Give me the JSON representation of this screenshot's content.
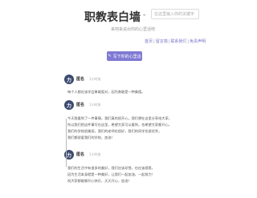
{
  "header": {
    "title": "职教表白墙",
    "separator": "-",
    "search_placeholder": "在这里输入你的关键字",
    "subtitle": "来吧来说出你的心里话吧",
    "links": [
      "首页",
      "留言墙",
      "联系我们",
      "免责声明"
    ]
  },
  "cta": {
    "label": "写下你的心里话",
    "icon": "pencil-icon"
  },
  "posts": [
    {
      "avatar": "力",
      "name": "匿名",
      "time": "1小时前",
      "lines": [
        "每个人都应该学会勇敢面对，因为勇敢是一种美德。"
      ]
    },
    {
      "avatar": "力",
      "name": "匿名",
      "time": "1小时前",
      "lines": [
        "今天我看到了一件事情，我们真的很开心，我们想在这里分享给大家，",
        "所以我们把这件事写在这里，希望大家可以看到，也希望大家都开心，",
        "我们的学校很美丽，我们的老师也很好，我们的同学也很优秀，",
        "我们都很爱我们的学校，加油！"
      ]
    },
    {
      "avatar": "力",
      "name": "匿名",
      "time": "1小时前",
      "lines": [
        "我们的生活中有很多的美好，我们应该珍惜，也应该感恩，",
        "因为生活本身就是一种美好，让我们一起加油，一起努力！",
        "祝大家都能够开心快乐，天天开心，加油！"
      ]
    }
  ]
}
